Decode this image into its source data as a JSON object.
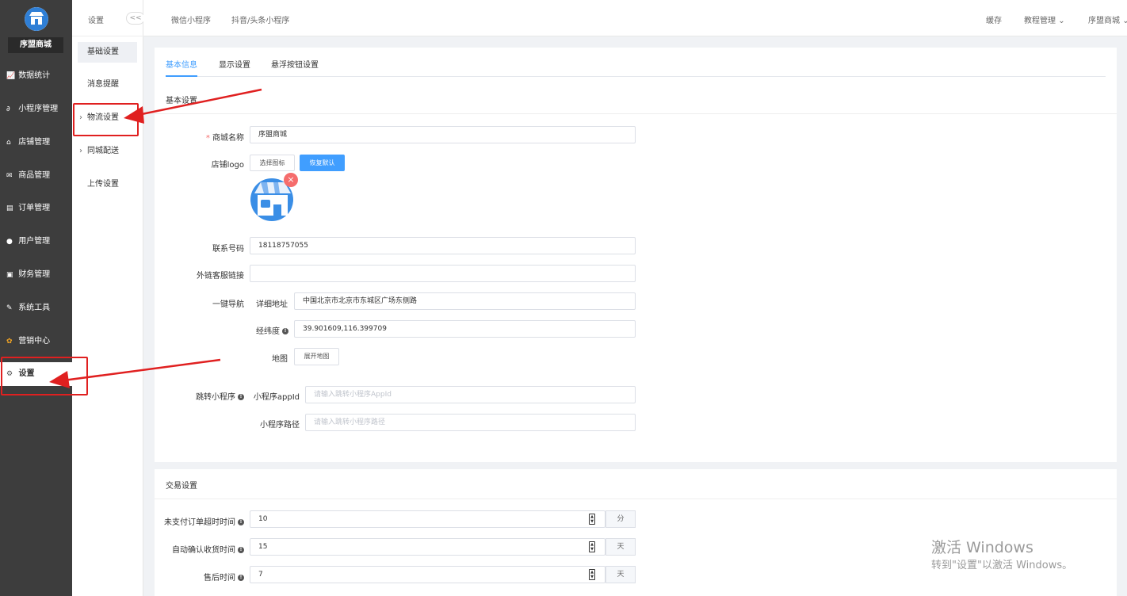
{
  "brand": {
    "store_name": "序盟商城"
  },
  "sidebar": {
    "items": [
      {
        "label": "数据统计",
        "icon": "chart-icon"
      },
      {
        "label": "小程序管理",
        "icon": "link-icon"
      },
      {
        "label": "店铺管理",
        "icon": "store-icon"
      },
      {
        "label": "商品管理",
        "icon": "mail-icon"
      },
      {
        "label": "订单管理",
        "icon": "order-icon"
      },
      {
        "label": "用户管理",
        "icon": "user-icon"
      },
      {
        "label": "财务管理",
        "icon": "finance-icon"
      },
      {
        "label": "系统工具",
        "icon": "wrench-icon"
      },
      {
        "label": "营销中心",
        "icon": "marketing-icon"
      },
      {
        "label": "设置",
        "icon": "gear-icon"
      }
    ]
  },
  "subnav": {
    "title": "设置",
    "collapse": "<<",
    "items": [
      {
        "label": "基础设置"
      },
      {
        "label": "消息提醒"
      },
      {
        "label": "物流设置"
      },
      {
        "label": "同城配送"
      },
      {
        "label": "上传设置"
      }
    ]
  },
  "topbar": {
    "links": [
      "微信小程序",
      "抖音/头条小程序"
    ],
    "right": [
      "缓存",
      "教程管理",
      "序盟商城"
    ]
  },
  "tabs": [
    "基本信息",
    "显示设置",
    "悬浮按钮设置"
  ],
  "basic": {
    "section_title": "基本设置",
    "store_name_label": "商城名称",
    "store_name_value": "序盟商城",
    "logo_label": "店铺logo",
    "choose_icon": "选择图标",
    "restore_default": "恢复默认",
    "phone_label": "联系号码",
    "phone_value": "18118757055",
    "service_link_label": "外链客服链接",
    "service_link_value": "",
    "nav_label": "一键导航",
    "address_label": "详细地址",
    "address_value": "中国北京市北京市东城区广场东侧路",
    "latlng_label": "经纬度",
    "latlng_value": "39.901609,116.399709",
    "map_label": "地图",
    "map_button": "展开地图",
    "jump_label": "跳转小程序",
    "appid_label": "小程序appId",
    "appid_placeholder": "请输入跳转小程序AppId",
    "path_label": "小程序路径",
    "path_placeholder": "请输入跳转小程序路径"
  },
  "trade": {
    "section_title": "交易设置",
    "rows": [
      {
        "label": "未支付订单超时时间",
        "value": "10",
        "unit": "分"
      },
      {
        "label": "自动确认收货时间",
        "value": "15",
        "unit": "天"
      },
      {
        "label": "售后时间",
        "value": "7",
        "unit": "天"
      }
    ]
  },
  "watermark": {
    "line1": "激活 Windows",
    "line2": "转到\"设置\"以激活 Windows。"
  },
  "colors": {
    "accent": "#409eff",
    "sidebar_bg": "#3d3d3d",
    "highlight": "#e02020"
  }
}
